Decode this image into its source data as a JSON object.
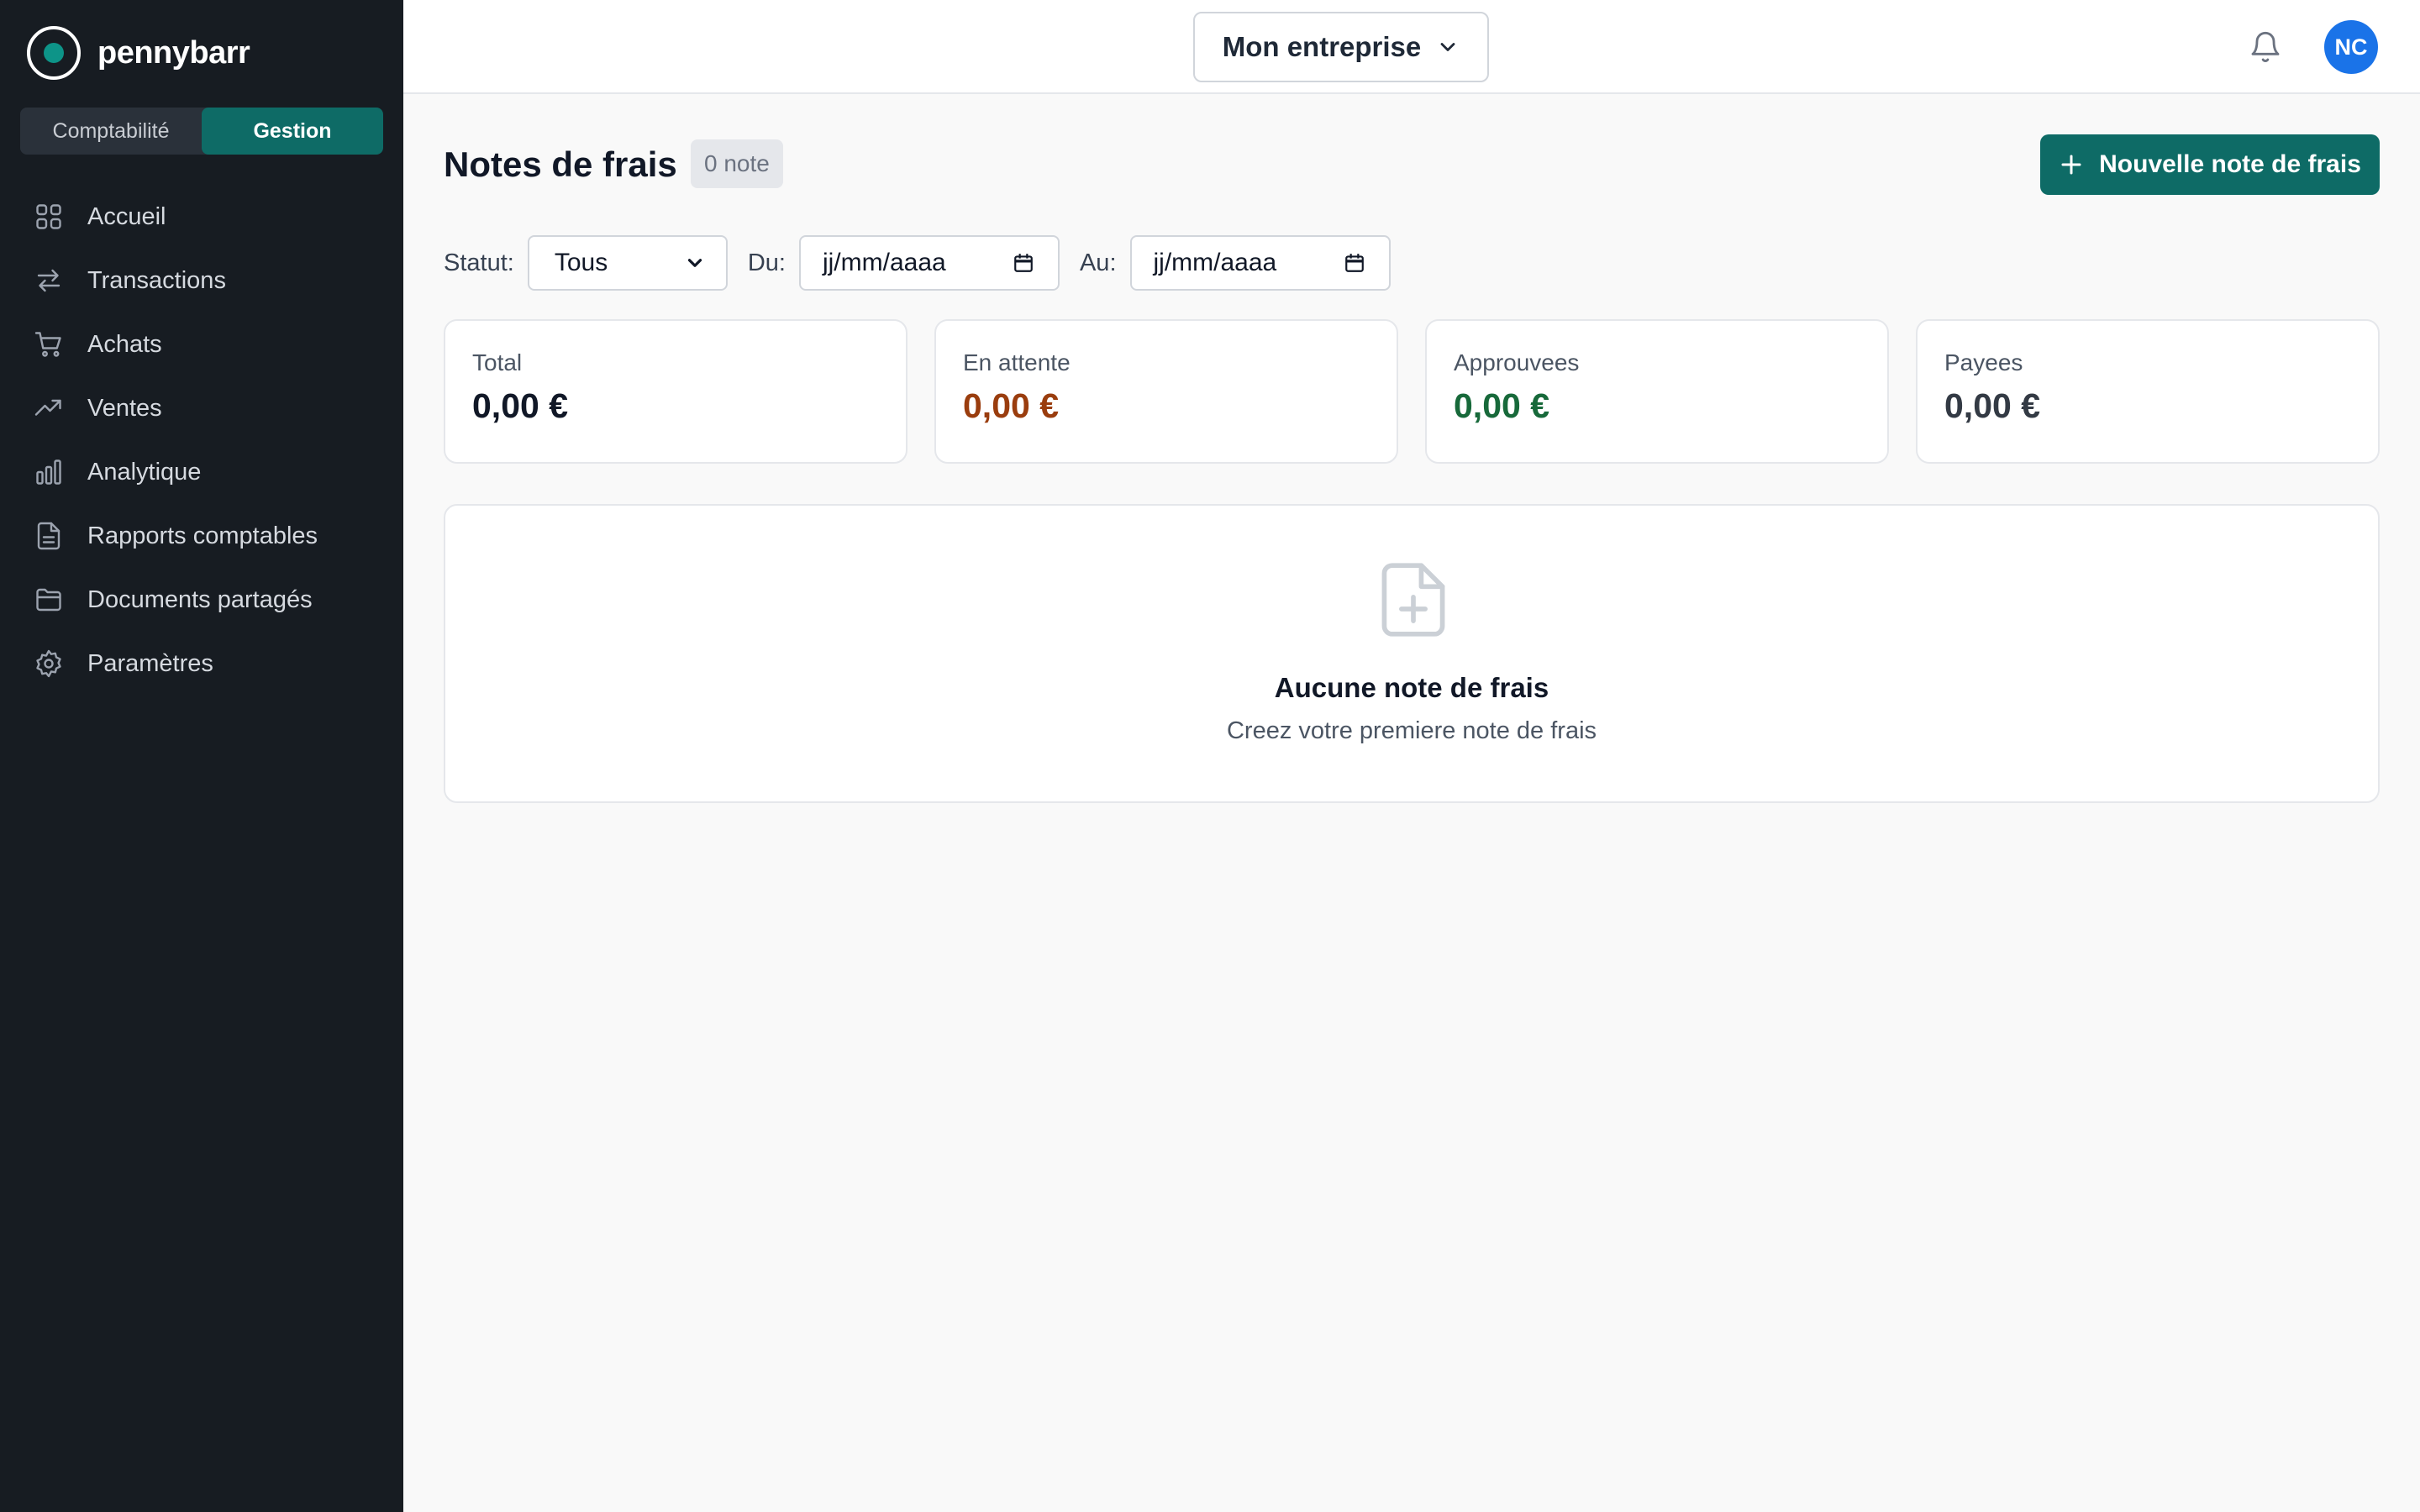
{
  "brand": {
    "name": "pennybarr",
    "accent": "#0d9488"
  },
  "mode_switch": [
    {
      "label": "Comptabilité",
      "active": false
    },
    {
      "label": "Gestion",
      "active": true
    }
  ],
  "sidebar": {
    "items": [
      {
        "label": "Accueil",
        "icon": "grid-icon"
      },
      {
        "label": "Transactions",
        "icon": "swap-arrows-icon"
      },
      {
        "label": "Achats",
        "icon": "cart-icon"
      },
      {
        "label": "Ventes",
        "icon": "trending-up-icon"
      },
      {
        "label": "Analytique",
        "icon": "bar-chart-icon"
      },
      {
        "label": "Rapports comptables",
        "icon": "document-icon"
      },
      {
        "label": "Documents partagés",
        "icon": "folder-icon"
      },
      {
        "label": "Paramètres",
        "icon": "gear-icon"
      }
    ]
  },
  "header": {
    "company": "Mon entreprise",
    "avatar_initials": "NC",
    "avatar_color": "#1a73e8"
  },
  "page": {
    "title": "Notes de frais",
    "count_badge": "0 note",
    "new_button": "Nouvelle note de frais",
    "primary_color": "#0e6b66"
  },
  "filters": {
    "status_label": "Statut:",
    "status_value": "Tous",
    "from_label": "Du:",
    "from_value": "jj/mm/aaaa",
    "to_label": "Au:",
    "to_value": "jj/mm/aaaa"
  },
  "summary": [
    {
      "label": "Total",
      "value": "0,00 €",
      "color": "#111827"
    },
    {
      "label": "En attente",
      "value": "0,00 €",
      "color": "#9a3d0e"
    },
    {
      "label": "Approuvees",
      "value": "0,00 €",
      "color": "#17693a"
    },
    {
      "label": "Payees",
      "value": "0,00 €",
      "color": "#333a44"
    }
  ],
  "empty_state": {
    "title": "Aucune note de frais",
    "subtitle": "Creez votre premiere note de frais"
  }
}
